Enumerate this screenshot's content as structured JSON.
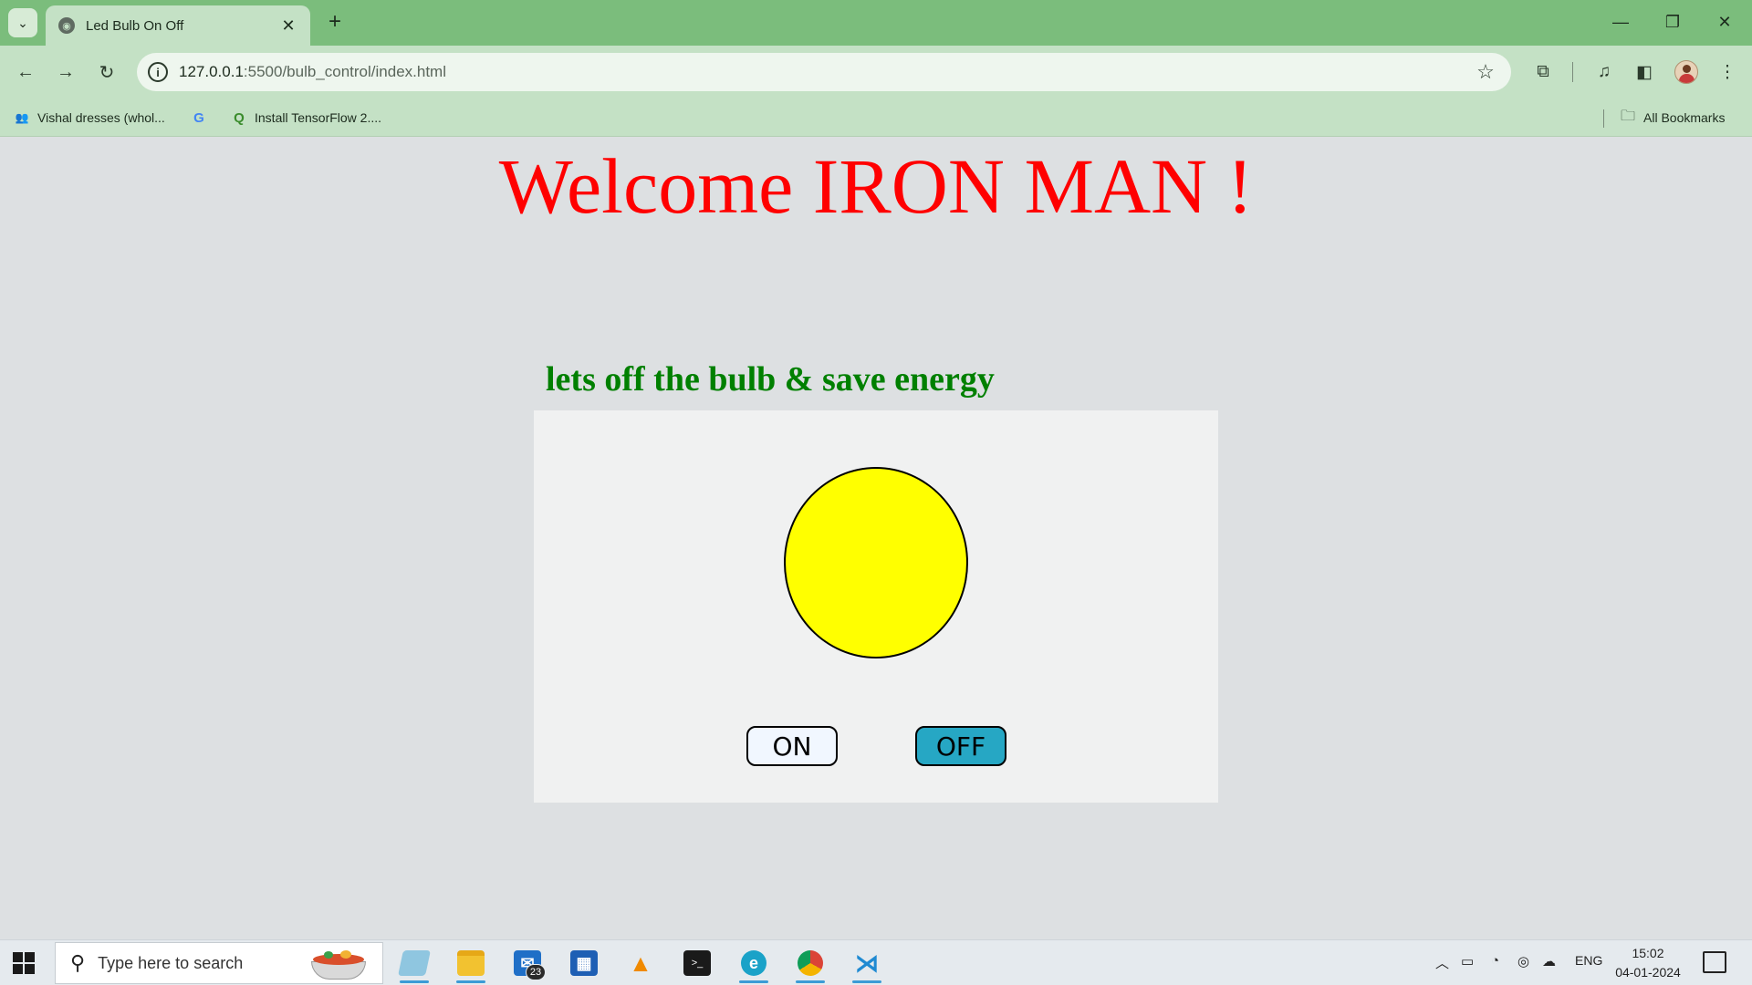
{
  "browser": {
    "tab_title": "Led Bulb On Off",
    "tab_close_glyph": "✕",
    "new_tab_glyph": "+",
    "url_host": "127.0.0.1",
    "url_rest": ":5500/bulb_control/index.html",
    "window_controls": {
      "minimize": "—",
      "restore": "❐",
      "close": "✕"
    }
  },
  "bookmarks": {
    "items": [
      {
        "label": "Vishal dresses (whol...",
        "icon": "people-icon",
        "color": "#4a6fd8"
      },
      {
        "label": "",
        "icon": "google-g-icon",
        "color": "#4285f4"
      },
      {
        "label": "Install TensorFlow 2....",
        "icon": "search-q-icon",
        "color": "#3a8c2c"
      }
    ],
    "all_bookmarks_label": "All Bookmarks"
  },
  "page": {
    "heading": "Welcome IRON MAN !",
    "subtitle": "lets off the bulb & save energy",
    "bulb_color": "#ffff00",
    "on_button_label": "ON",
    "off_button_label": "OFF",
    "heading_color": "#ff0000",
    "subtitle_color": "#008000",
    "off_button_color": "#26a7c4"
  },
  "taskbar": {
    "search_placeholder": "Type here to search",
    "mail_badge": "23",
    "tray_language": "ENG",
    "time": "15:02",
    "date": "04-01-2024"
  }
}
